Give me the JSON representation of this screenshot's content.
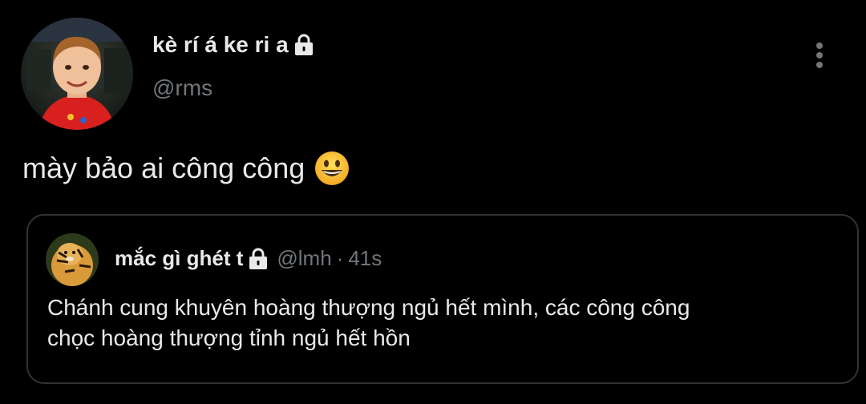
{
  "tweet": {
    "author": {
      "display_name": "kè rí á ke ri a",
      "handle": "@rms",
      "protected_icon": "lock-icon",
      "avatar": "avatar-child-red-shirt"
    },
    "more_icon": "more-vertical-icon",
    "text": "mày bảo ai công công",
    "emoji": "grinning-face-emoji",
    "quoted": {
      "display_name": "mắc gì ghét t",
      "handle": "@lmh",
      "separator": "·",
      "time": "41s",
      "protected_icon": "lock-icon",
      "avatar": "avatar-tiger-figure",
      "text_lines": [
        "Chánh cung khuyên hoàng thượng ngủ hết mình, các công công",
        "chọc hoàng thượng tỉnh ngủ hết hồn"
      ]
    }
  },
  "colors": {
    "background": "#000000",
    "text_primary": "#e7e9ea",
    "text_secondary": "#71767b",
    "border": "#2f3336"
  }
}
